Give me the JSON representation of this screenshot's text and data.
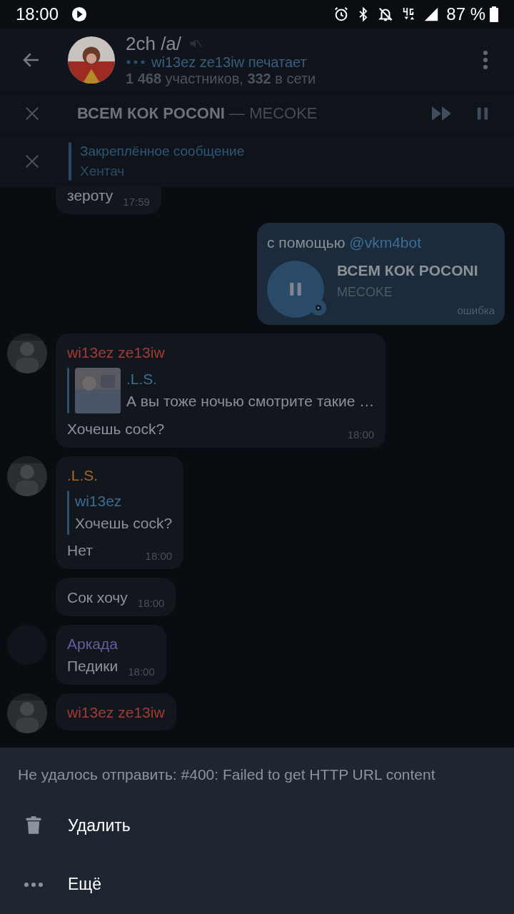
{
  "status_bar": {
    "time": "18:00",
    "battery": "87 %"
  },
  "header": {
    "title": "2ch /a/",
    "muted": true,
    "typing": "wi13ez ze13iw печатает",
    "members": "**1 468** участников, **332** в сети"
  },
  "player": {
    "title": "ВСЕМ КОК POCONI",
    "performer": "— MECOKE",
    "playing": true
  },
  "pinned": {
    "label": "Закреплённое сообщение",
    "text": "Хентач"
  },
  "messages": [
    {
      "kind": "incoming",
      "text": "зероту",
      "time": "17:59"
    },
    {
      "kind": "outgoing_audio",
      "via": "с помощью",
      "bot": "@vkm4bot",
      "title": "ВСЕМ КОК POCONI",
      "performer": "MECOKE",
      "status": "ошибка",
      "playing": true
    },
    {
      "kind": "incoming",
      "sender": "wi13ez ze13iw",
      "color": "#a33a35",
      "reply": {
        "name": ".L.S.",
        "text": "А вы тоже ночью смотрите такие …",
        "thumb": true
      },
      "text": "Хочешь cock?",
      "time": "18:00"
    },
    {
      "kind": "incoming",
      "sender": ".L.S.",
      "color": "#a8652a",
      "reply": {
        "name": "wi13ez",
        "text": "Хочешь cock?",
        "thumb": false
      },
      "text": "Нет",
      "time": "18:00"
    },
    {
      "kind": "incoming",
      "text": "Сок хочу",
      "time": "18:00"
    },
    {
      "kind": "incoming",
      "sender": "Аркада",
      "color": "#6a5a9e",
      "avatar": {
        "kind": "placeholder"
      },
      "text": "Педики",
      "time": "18:00"
    },
    {
      "kind": "incoming",
      "sender": "wi13ez ze13iw",
      "color": "#a33a35"
    }
  ],
  "sheet": {
    "title": "Не удалось отправить: #400: Failed to get HTTP URL content",
    "items": [
      {
        "kind": "delete",
        "label": "Удалить"
      },
      {
        "kind": "more",
        "label": "Ещё"
      }
    ]
  }
}
